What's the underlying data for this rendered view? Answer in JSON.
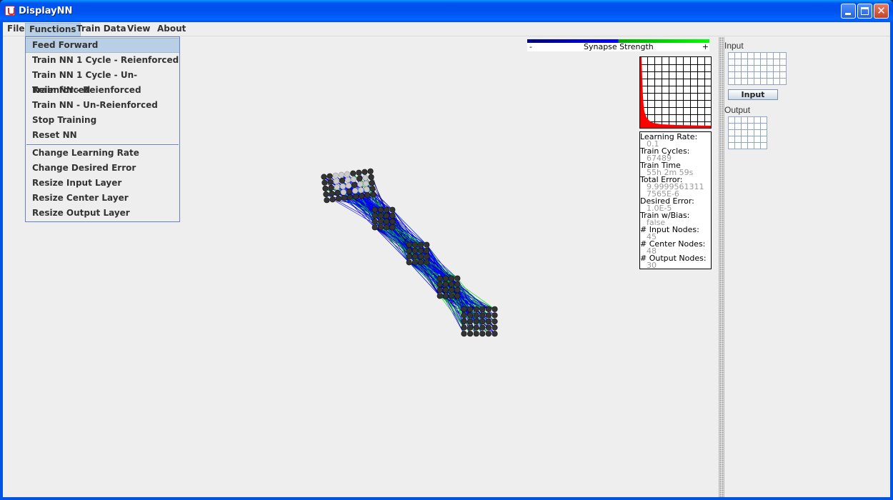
{
  "window": {
    "title": "DisplayNN"
  },
  "menubar": {
    "items": [
      {
        "label": "File"
      },
      {
        "label": "Functions"
      },
      {
        "label": "Train Data"
      },
      {
        "label": "View"
      },
      {
        "label": "About"
      }
    ]
  },
  "functions_menu": {
    "items": [
      "Feed Forward",
      "Train NN 1 Cycle - Reienforced",
      "Train NN 1 Cycle - Un-Reienforced",
      "Train NN - Reienforced",
      "Train NN - Un-Reienforced",
      "Stop Training",
      "Reset NN",
      "Change Learning Rate",
      "Change Desired Error",
      "Resize Input Layer",
      "Resize Center Layer",
      "Resize Output Layer"
    ],
    "highlighted": "Feed Forward"
  },
  "legend": {
    "minus": "-",
    "label": "Synapse Strength",
    "plus": "+"
  },
  "stats": [
    {
      "label": "Learning Rate:",
      "value": "0.1"
    },
    {
      "label": "Train Cycles:",
      "value": "67489"
    },
    {
      "label": "Train Time",
      "value": "55h 2m 59s"
    },
    {
      "label": "Total Error:",
      "value": "9.9999561311\n7565E-6"
    },
    {
      "label": "Desired Error:",
      "value": "1.0E-5"
    },
    {
      "label": "Train w/Bias:",
      "value": "false"
    },
    {
      "label": "# Input Nodes:",
      "value": "45"
    },
    {
      "label": "# Center Nodes:",
      "value": "48"
    },
    {
      "label": "# Output Nodes:",
      "value": "30"
    }
  ],
  "right_panel": {
    "input_label": "Input",
    "input_button": "Input",
    "output_label": "Output",
    "input_grid": {
      "cols": 9,
      "rows": 5
    },
    "output_grid": {
      "cols": 6,
      "rows": 5
    }
  },
  "colors": {
    "synapse_negative": "#000080",
    "synapse_mid": "#0000ff",
    "synapse_positive": "#00cc00",
    "error_curve": "#ff0000",
    "node": "#333333",
    "active_input_node": "#cccccc",
    "menu_highlight": "#b8cfe5"
  }
}
